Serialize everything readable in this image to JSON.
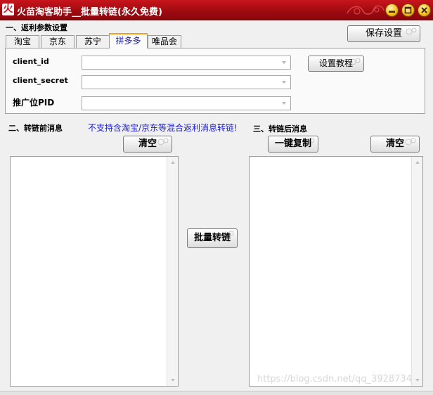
{
  "window": {
    "title": "火苗淘客助手__批量转链(永久免费)",
    "icon": "flame-app-icon",
    "colors": {
      "titlebar": "#b01016",
      "accent": "#f0a020",
      "warning_text": "#1a1ae0"
    }
  },
  "section1": {
    "heading": "一、返利参数设置",
    "save_button": "保存设置",
    "tabs": [
      {
        "label": "淘宝",
        "active": false
      },
      {
        "label": "京东",
        "active": false
      },
      {
        "label": "苏宁",
        "active": false
      },
      {
        "label": "拼多多",
        "active": true
      },
      {
        "label": "唯品会",
        "active": false
      }
    ],
    "fields": [
      {
        "label": "client_id",
        "value": ""
      },
      {
        "label": "client_secret",
        "value": ""
      },
      {
        "label": "推广位PID",
        "value": ""
      }
    ],
    "tutorial_button": "设置教程"
  },
  "section2": {
    "heading": "二、转链前消息",
    "warning": "不支持含淘宝/京东等混合返利消息转链!",
    "clear_button": "清空",
    "content": ""
  },
  "convert_button": "批量转链",
  "section3": {
    "heading": "三、转链后消息",
    "copy_button": "一键复制",
    "clear_button": "清空",
    "content": ""
  },
  "watermark": "https://blog.csdn.net/qq_3928734"
}
